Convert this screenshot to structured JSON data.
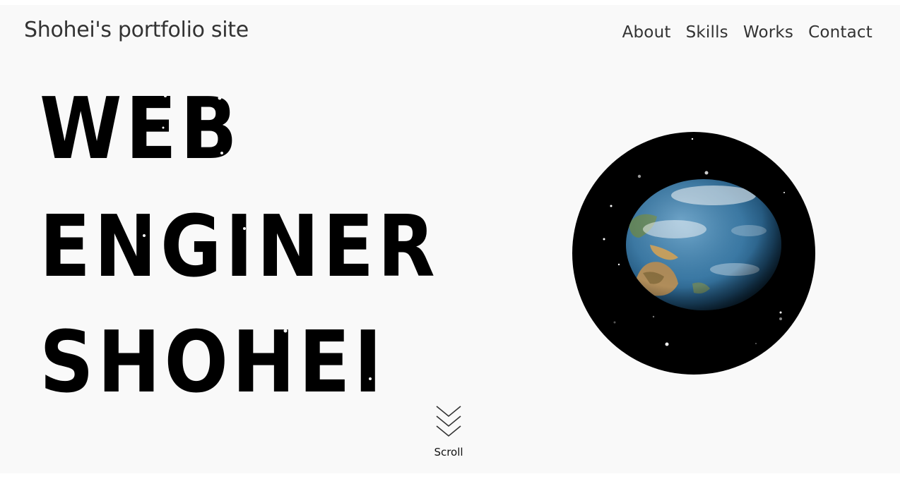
{
  "header": {
    "site_title": "Shohei's portfolio site",
    "nav": [
      {
        "label": "About"
      },
      {
        "label": "Skills"
      },
      {
        "label": "Works"
      },
      {
        "label": "Contact"
      }
    ]
  },
  "hero": {
    "lines": [
      "WEB",
      "ENGINER",
      "SHOHEI"
    ]
  },
  "scroll": {
    "label": "Scroll",
    "icon": "chevrons-down-icon"
  },
  "globe": {
    "icon": "earth-globe-icon"
  },
  "colors": {
    "background": "#f9f9f9",
    "text": "#333333",
    "hero_text": "#000000",
    "space": "#000000",
    "ocean": "#3b7aa6"
  }
}
